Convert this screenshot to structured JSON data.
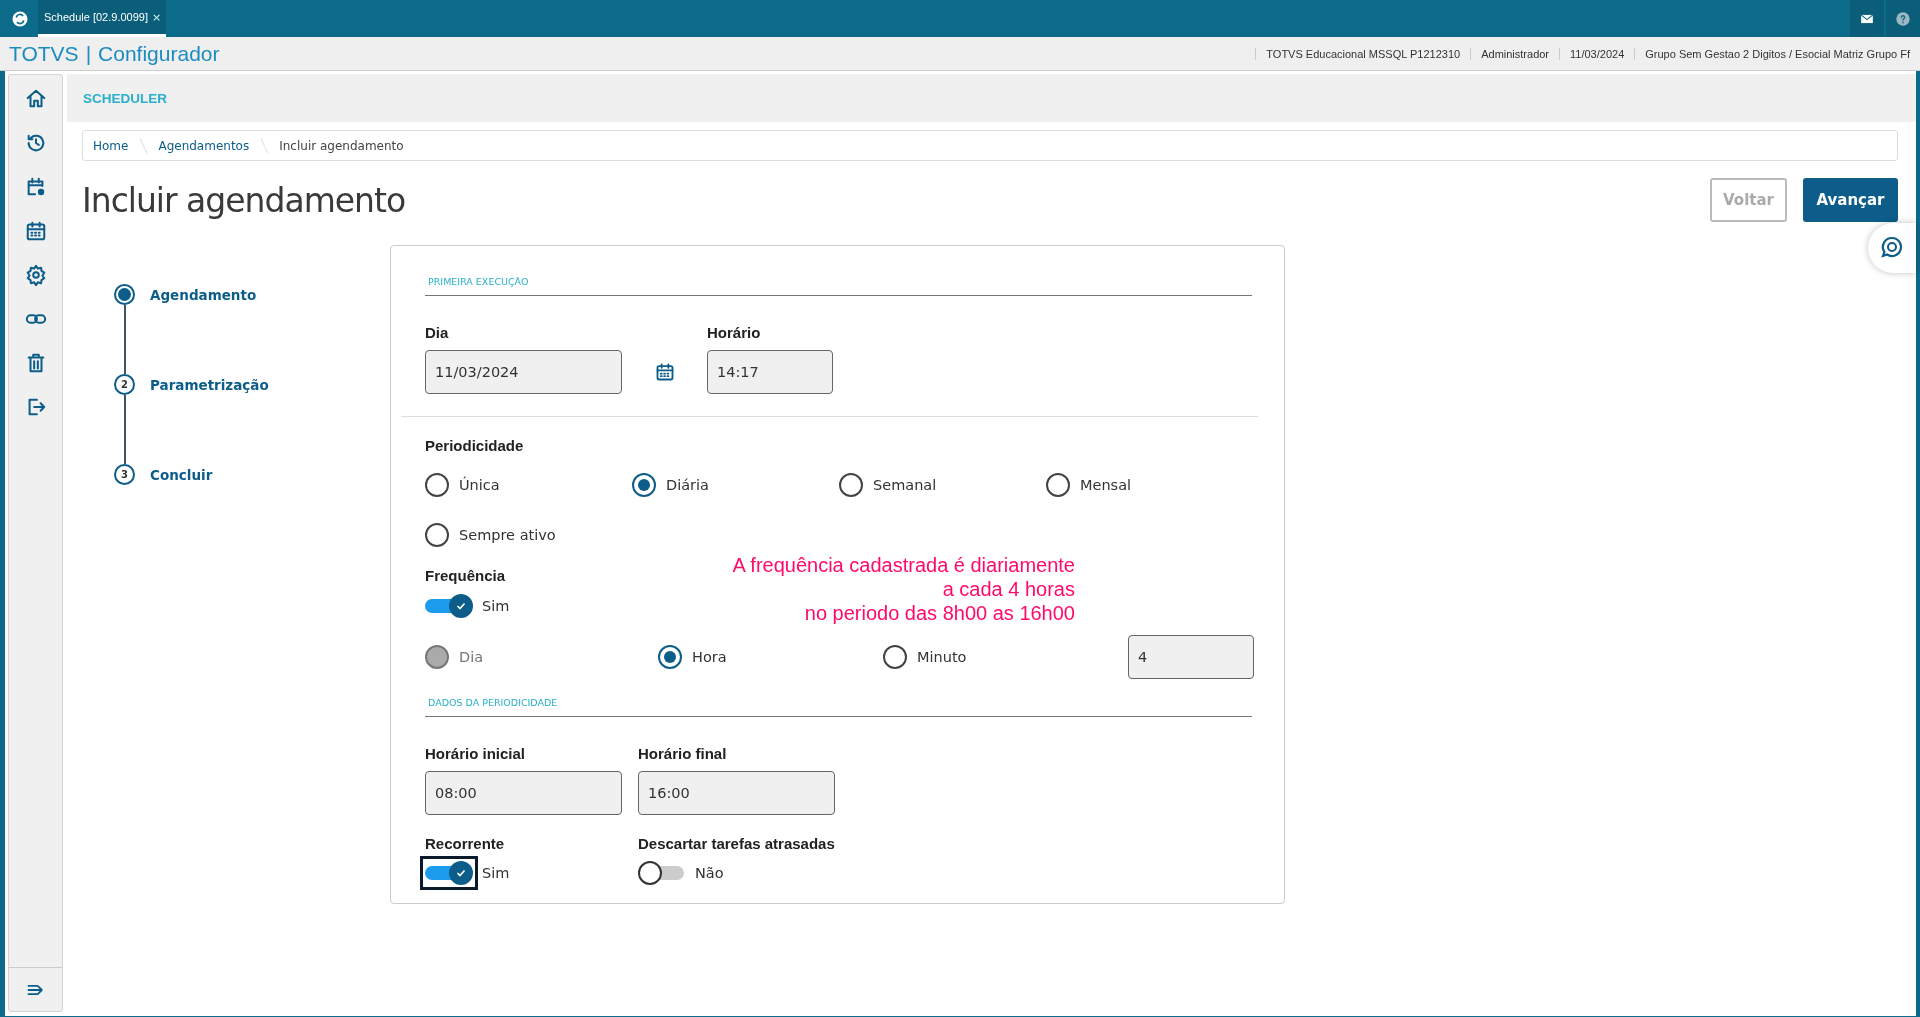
{
  "app_tab": {
    "title": "Schedule [02.9.0099]",
    "close": "×"
  },
  "header": {
    "brand": "TOTVS",
    "separator": "|",
    "module": "Configurador",
    "info": [
      "TOTVS Educacional MSSQL P1212310",
      "Administrador",
      "11/03/2024",
      "Grupo Sem Gestao 2 Digitos / Esocial Matriz Grupo Ff"
    ]
  },
  "page": {
    "section": "SCHEDULER",
    "breadcrumb": [
      "Home",
      "Agendamentos",
      "Incluir agendamento"
    ],
    "title": "Incluir agendamento",
    "buttons": [
      {
        "label": "Voltar",
        "kind": "secondary",
        "disabled": true
      },
      {
        "label": "Avançar",
        "kind": "primary",
        "disabled": false
      }
    ]
  },
  "stepper": [
    {
      "label": "Agendamento",
      "selected": true
    },
    {
      "number": "2",
      "label": "Parametrização",
      "selected": false
    },
    {
      "number": "3",
      "label": "Concluir",
      "selected": false
    }
  ],
  "form": {
    "first_run_title": "PRIMEIRA EXECUÇÃO",
    "day": {
      "label": "Dia",
      "value": "11/03/2024"
    },
    "time": {
      "label": "Horário",
      "value": "14:17"
    },
    "periodicity": {
      "label": "Periodicidade",
      "options": [
        {
          "label": "Única",
          "selected": false,
          "disabled": false
        },
        {
          "label": "Diária",
          "selected": true,
          "disabled": false
        },
        {
          "label": "Semanal",
          "selected": false,
          "disabled": false
        },
        {
          "label": "Mensal",
          "selected": false,
          "disabled": false
        },
        {
          "label": "Sempre ativo",
          "selected": false,
          "disabled": false
        }
      ]
    },
    "frequency": {
      "label": "Frequência",
      "toggle": {
        "label": "Sim",
        "on": true,
        "focused": false
      },
      "note": [
        "A frequência cadastrada é diariamente",
        "a cada 4 horas",
        "no periodo das 8h00 as 16h00"
      ],
      "options": [
        {
          "label": "Dia",
          "selected": false,
          "disabled": true
        },
        {
          "label": "Hora",
          "selected": true,
          "disabled": false
        },
        {
          "label": "Minuto",
          "selected": false,
          "disabled": false
        }
      ],
      "value": "4"
    },
    "period_title": "DADOS DA PERIODICIDADE",
    "start": {
      "label": "Horário inicial",
      "value": "08:00"
    },
    "end": {
      "label": "Horário final",
      "value": "16:00"
    },
    "recurrent": {
      "label": "Recorrente",
      "toggle": {
        "label": "Sim",
        "on": true,
        "focused": true
      }
    },
    "discard": {
      "label": "Descartar tarefas atrasadas",
      "toggle": {
        "label": "Não",
        "on": false,
        "focused": false
      }
    }
  }
}
